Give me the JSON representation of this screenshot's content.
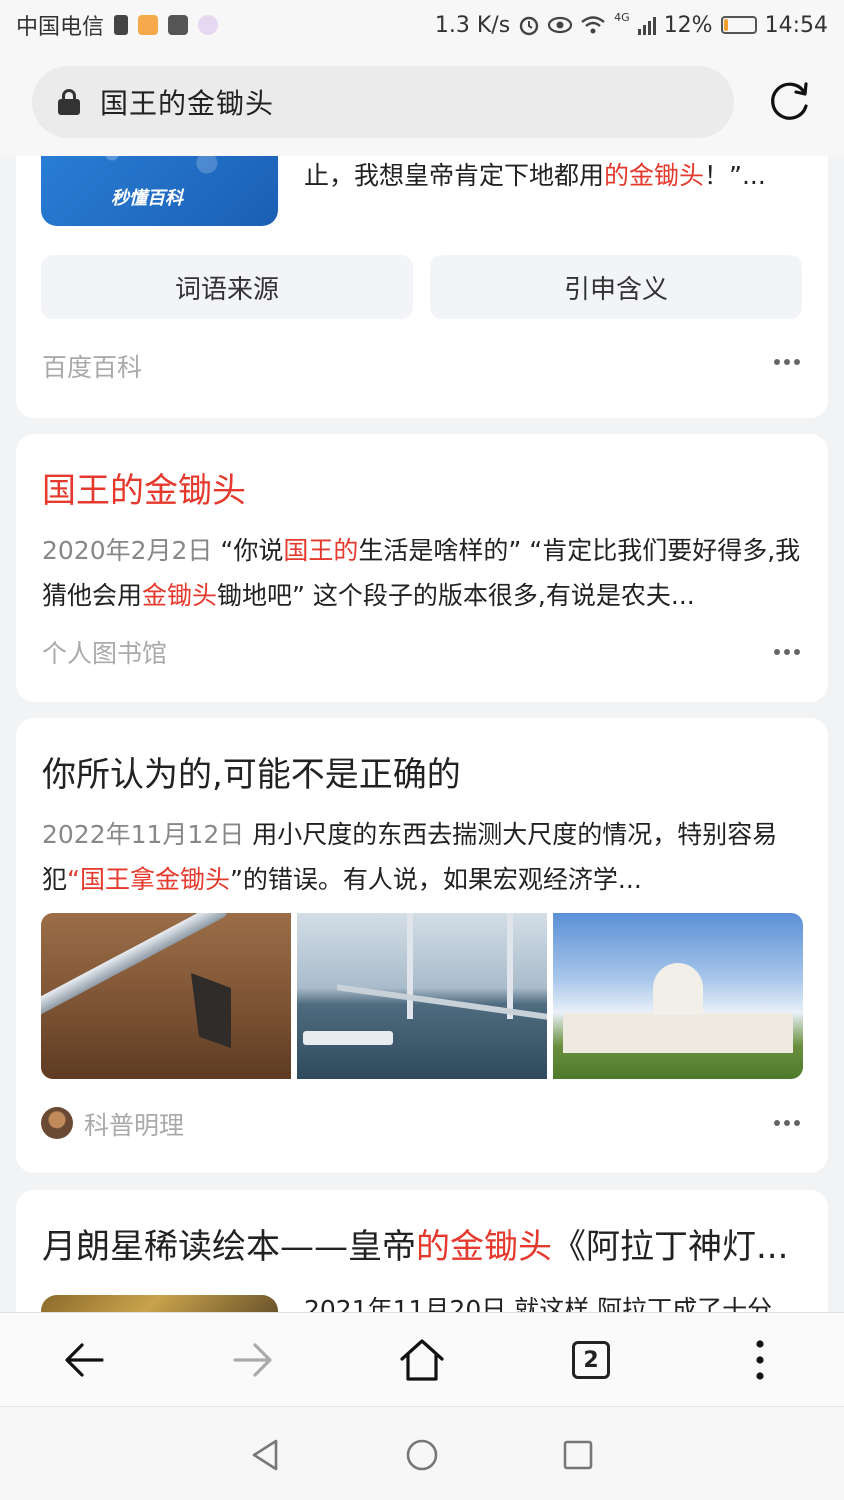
{
  "status_bar": {
    "carrier": "中国电信",
    "net_speed": "1.3 K/s",
    "network_type": "4G",
    "battery": "12%",
    "battery_level": 0.12,
    "time": "14:54"
  },
  "address_bar": {
    "query": "国王的金锄头"
  },
  "results": [
    {
      "thumb_logo": "秒懂百科",
      "snippet_pre": "止，我想皇帝肯定下地都用",
      "snippet_hl": "的金锄头",
      "snippet_post": "！”...",
      "chips": [
        "词语来源",
        "引申含义"
      ],
      "source": "百度百科"
    },
    {
      "title": "国王的金锄头",
      "date": "2020年2月2日",
      "snippet_1": " “你说",
      "snippet_hl_1": "国王的",
      "snippet_2": "生活是啥样的” “肯定比我们要好得多,我猜他会用",
      "snippet_hl_2": "金锄头",
      "snippet_3": "锄地吧” 这个段子的版本很多,有说是农夫...",
      "source": "个人图书馆"
    },
    {
      "title": "你所认为的,可能不是正确的",
      "date": "2022年11月12日",
      "snippet_1": " 用小尺度的东西去揣测大尺度的情况，特别容易犯",
      "snippet_hl_1": "“国王拿金锄头",
      "snippet_2": "”的错误。有人说，如果宏观经济学...",
      "source": "科普明理"
    },
    {
      "title_pre": "月朗星稀读绘本——皇帝",
      "title_hl": "的金锄头",
      "title_post": "《阿拉丁神灯...",
      "snippet": "2021年11月20日  就这样 阿拉丁成了十分"
    }
  ],
  "toolbar": {
    "tab_count": "2"
  },
  "colors": {
    "highlight": "#e5392d",
    "background": "#f2f3f5"
  }
}
